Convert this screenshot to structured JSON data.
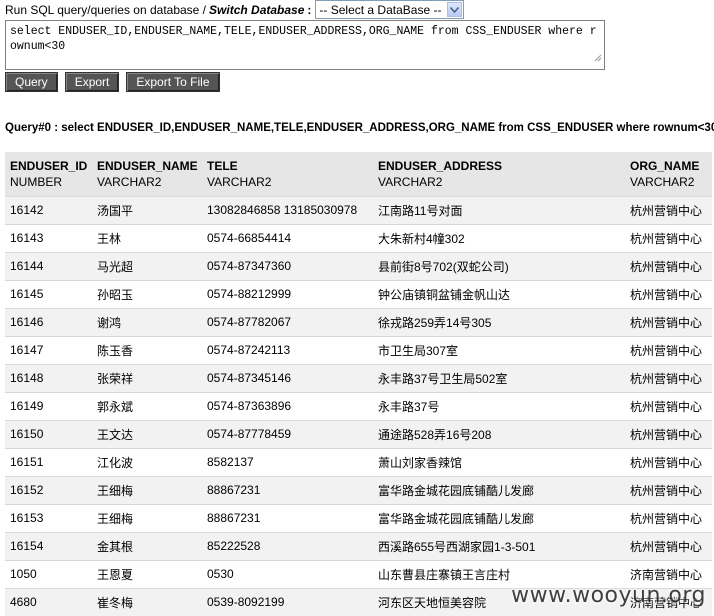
{
  "header": {
    "run_label": "Run SQL query/queries on database /",
    "switch_label": "Switch Database",
    "colon": ":",
    "select_value": "-- Select a DataBase --"
  },
  "query": {
    "text": "select ENDUSER_ID,ENDUSER_NAME,TELE,ENDUSER_ADDRESS,ORG_NAME from CSS_ENDUSER where rownum<30"
  },
  "buttons": {
    "query": "Query",
    "export": "Export",
    "export_file": "Export To File"
  },
  "result_title": "Query#0 : select ENDUSER_ID,ENDUSER_NAME,TELE,ENDUSER_ADDRESS,ORG_NAME from CSS_ENDUSER where rownum<30",
  "table": {
    "columns": [
      {
        "name": "ENDUSER_ID",
        "type": "NUMBER"
      },
      {
        "name": "ENDUSER_NAME",
        "type": "VARCHAR2"
      },
      {
        "name": "TELE",
        "type": "VARCHAR2"
      },
      {
        "name": "ENDUSER_ADDRESS",
        "type": "VARCHAR2"
      },
      {
        "name": "ORG_NAME",
        "type": "VARCHAR2"
      }
    ],
    "rows": [
      [
        "16142",
        "汤国平",
        "13082846858 13185030978",
        "江南路11号对面",
        "杭州营销中心"
      ],
      [
        "16143",
        "王林",
        "0574-66854414",
        "大朱新村4幢302",
        "杭州营销中心"
      ],
      [
        "16144",
        "马光超",
        "0574-87347360",
        "县前街8号702(双蛇公司)",
        "杭州营销中心"
      ],
      [
        "16145",
        "孙昭玉",
        "0574-88212999",
        "钟公庙镇铜盆铺金帆山达",
        "杭州营销中心"
      ],
      [
        "16146",
        "谢鸿",
        "0574-87782067",
        "徐戎路259弄14号305",
        "杭州营销中心"
      ],
      [
        "16147",
        "陈玉香",
        "0574-87242113",
        "市卫生局307室",
        "杭州营销中心"
      ],
      [
        "16148",
        "张荣祥",
        "0574-87345146",
        "永丰路37号卫生局502室",
        "杭州营销中心"
      ],
      [
        "16149",
        "郭永斌",
        "0574-87363896",
        "永丰路37号",
        "杭州营销中心"
      ],
      [
        "16150",
        "王文达",
        "0574-87778459",
        "通途路528弄16号208",
        "杭州营销中心"
      ],
      [
        "16151",
        "江化波",
        "8582137",
        "萧山刘家香辣馆",
        "杭州营销中心"
      ],
      [
        "16152",
        "王细梅",
        "88867231",
        "富华路金城花园底铺酷儿发廊",
        "杭州营销中心"
      ],
      [
        "16153",
        "王细梅",
        "88867231",
        "富华路金城花园底铺酷儿发廊",
        "杭州营销中心"
      ],
      [
        "16154",
        "金其根",
        "85222528",
        "西溪路655号西湖家园1-3-501",
        "杭州营销中心"
      ],
      [
        "1050",
        "王恩夏",
        "0530",
        "山东曹县庄寨镇王言庄村",
        "济南营销中心"
      ],
      [
        "4680",
        "崔冬梅",
        "0539-8092199",
        "河东区天地恒美容院",
        "济南营销中心"
      ]
    ]
  },
  "watermark": "www.wooyun.org"
}
